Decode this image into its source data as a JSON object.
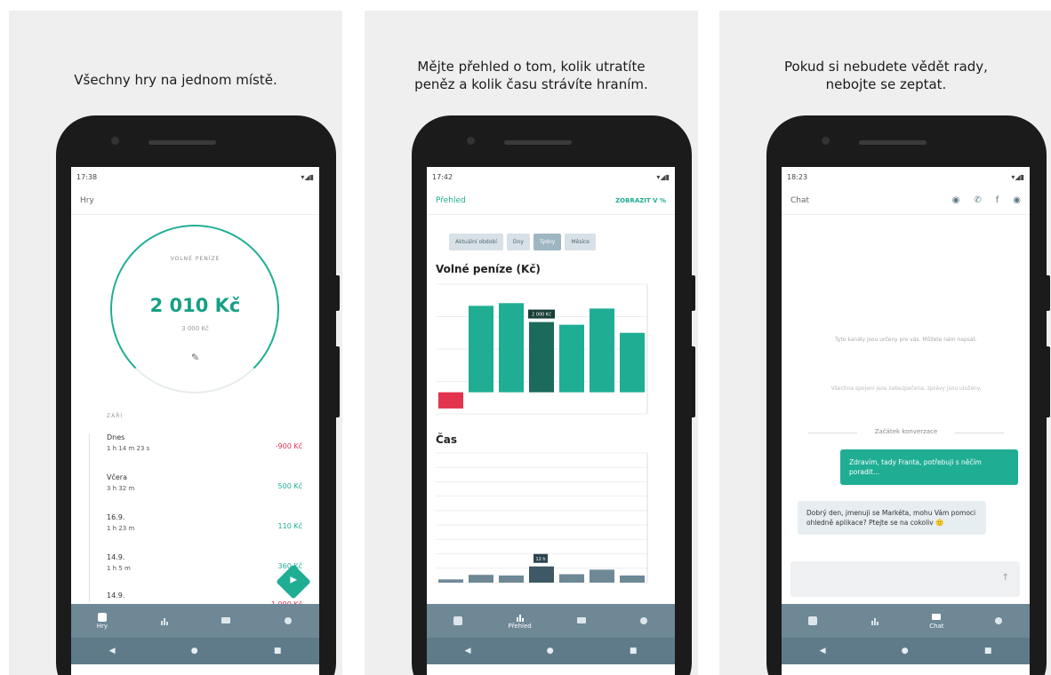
{
  "panels": [
    {
      "headline": "Všechny hry na jednom místě.",
      "status_time": "17:38",
      "app_title": "Hry",
      "ring": {
        "label": "VOLNÉ PENÍZE",
        "value": "2 010 Kč",
        "sub": "3 000 Kč"
      },
      "section_label": "ZÁŘÍ",
      "days": [
        {
          "date": "Dnes",
          "time": "1 h 14 m 23 s",
          "amount": "-900 Kč",
          "sign": "neg"
        },
        {
          "date": "Včera",
          "time": "3 h 32 m",
          "amount": "500 Kč",
          "sign": "pos"
        },
        {
          "date": "16.9.",
          "time": "1 h 23 m",
          "amount": "110 Kč",
          "sign": "pos"
        },
        {
          "date": "14.9.",
          "time": "1 h 5 m",
          "amount": "360 Kč",
          "sign": "pos"
        },
        {
          "date": "14.9.",
          "time": "",
          "amount": "-1 000 Kč",
          "sign": "neg"
        }
      ],
      "nav": [
        "Hry",
        "",
        "",
        ""
      ]
    },
    {
      "headline_line1": "Mějte přehled o tom, kolik utratíte",
      "headline_line2": "peněz a kolik času strávíte hraním.",
      "status_time": "17:42",
      "app_title": "Přehled",
      "action": "ZOBRAZIT V %",
      "filters": [
        "Aktuální období",
        "Dny",
        "Týdny",
        "Měsíce"
      ],
      "active_filter": "Týdny",
      "chart_money_title": "Volné peníze (Kč)",
      "chart_time_title": "Čas",
      "bar_tooltip": "2 000 Kč",
      "time_tooltip": "12 h",
      "nav": [
        "",
        "",
        "Přehled",
        "",
        ""
      ]
    },
    {
      "headline_line1": "Pokud si nebudete vědět rady,",
      "headline_line2": "nebojte se zeptat.",
      "status_time": "18:23",
      "app_title": "Chat",
      "info1": "Tyto kanály jsou určeny pro vás. Můžete nám napsat.",
      "info2": "Všechna spojení jsou zabezpečena, zprávy jsou uloženy.",
      "conv_start": "Začátek konverzace",
      "msg_out": "Zdravím, tady Franta, potřebuji s něčím poradit...",
      "msg_in": "Dobrý den, jmenuji se Markéta, mohu Vám pomoci ohledně aplikace? Ptejte se na cokoliv 🙂",
      "nav": [
        "",
        "",
        "Chat",
        ""
      ]
    }
  ],
  "chart_data": [
    {
      "type": "bar",
      "title": "Volné peníze (Kč)",
      "categories": [
        "",
        "",
        "",
        "",
        "",
        "",
        ""
      ],
      "values": [
        -300,
        1600,
        1650,
        1300,
        1250,
        1550,
        1100
      ],
      "colors": [
        "#e2344f",
        "#1fae94",
        "#1fae94",
        "#1b6a5c",
        "#1fae94",
        "#1fae94",
        "#1fae94"
      ],
      "ylim": [
        -400,
        2000
      ]
    },
    {
      "type": "bar",
      "title": "Čas",
      "categories": [
        "",
        "",
        "",
        "",
        "",
        "",
        ""
      ],
      "values": [
        0.5,
        1.2,
        1.1,
        2.5,
        1.3,
        2.0,
        1.1
      ],
      "ylim": [
        0,
        20
      ]
    }
  ],
  "colors": {
    "accent": "#1fae94",
    "accent_dark": "#1b6a5c",
    "negative": "#e2344f",
    "nav": "#6e8896"
  }
}
